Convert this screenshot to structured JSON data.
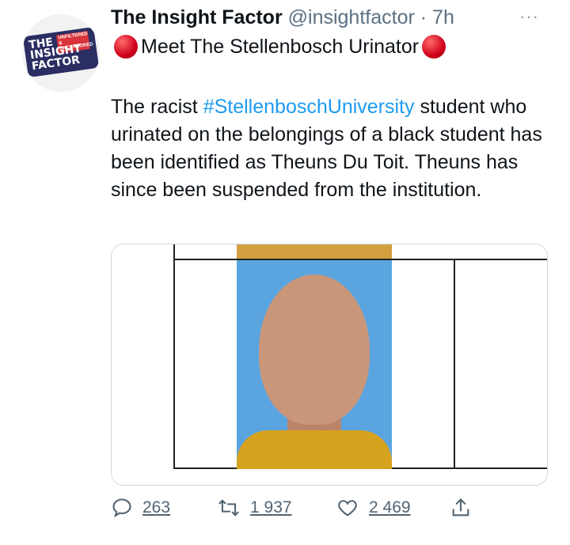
{
  "account": {
    "logo_text": "THE INSIGHT FACTOR",
    "logo_tag": "UNFILTERED & UNCENSORED"
  },
  "header": {
    "name": "The Insight Factor",
    "handle": "@insightfactor",
    "separator": "·",
    "time": "7h",
    "more": "···"
  },
  "headline": "Meet The Stellenbosch Urinator",
  "body": {
    "prefix": "The racist ",
    "hashtag": "#StellenboschUniversity",
    "suffix": " student who urinated on the belongings of a black student has been identified as Theuns Du Toit. Theuns has since been suspended from the institution."
  },
  "actions": {
    "replies": "263",
    "retweets": "1 937",
    "likes": "2 469"
  },
  "colors": {
    "accent": "#1d9bf0",
    "muted": "#5b7083",
    "red_circle": "#d0021b"
  }
}
